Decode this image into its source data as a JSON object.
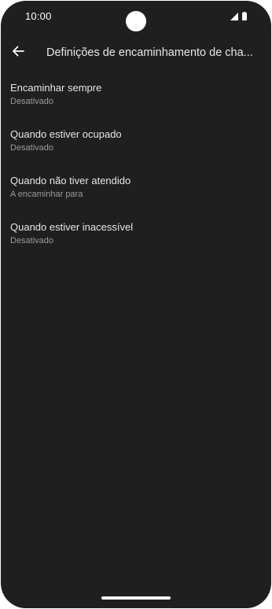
{
  "status_bar": {
    "time": "10:00",
    "icons": [
      "signal-icon",
      "battery-icon"
    ]
  },
  "app_bar": {
    "back_icon": "arrow-left-icon",
    "title": "Definições de encaminhamento de cha..."
  },
  "settings": [
    {
      "title": "Encaminhar sempre",
      "summary": "Desativado"
    },
    {
      "title": "Quando estiver ocupado",
      "summary": "Desativado"
    },
    {
      "title": "Quando não tiver atendido",
      "summary": "A encaminhar para"
    },
    {
      "title": "Quando estiver inacessível",
      "summary": "Desativado"
    }
  ],
  "colors": {
    "background": "#1f1f1f",
    "primary_text": "#e6e6e6",
    "secondary_text": "#9a9a9a"
  }
}
